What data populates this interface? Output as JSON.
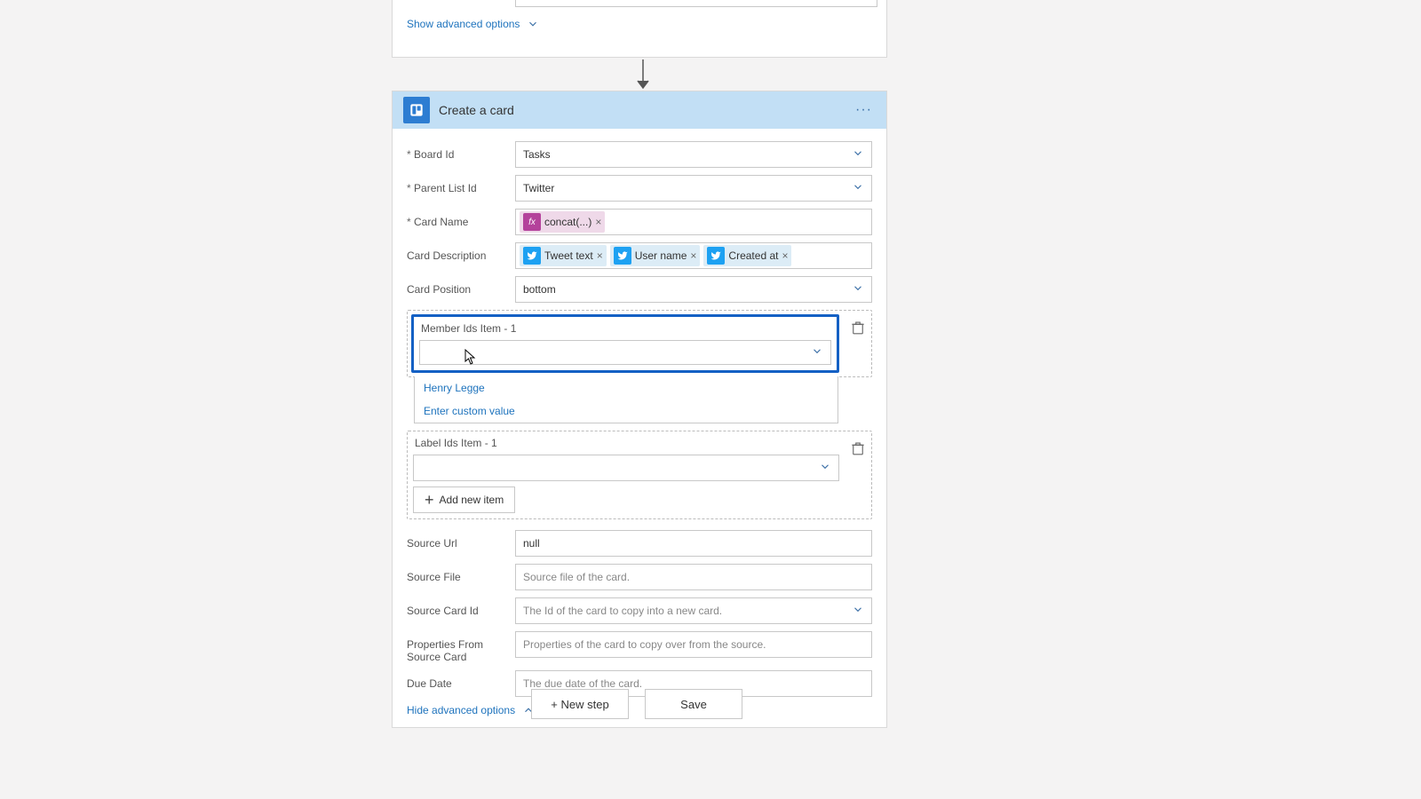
{
  "top_card": {
    "show_advanced": "Show advanced options"
  },
  "main_card": {
    "title": "Create a card",
    "fields": {
      "board_id": {
        "label": "Board Id",
        "value": "Tasks"
      },
      "parent_list": {
        "label": "Parent List Id",
        "value": "Twitter"
      },
      "card_name": {
        "label": "Card Name",
        "token_fx": "concat(...)"
      },
      "card_desc": {
        "label": "Card Description",
        "t1": "Tweet text",
        "t2": "User name",
        "t3": "Created at"
      },
      "card_pos": {
        "label": "Card Position",
        "value": "bottom"
      },
      "member_ids": {
        "label": "Member Ids Item - 1",
        "opt1": "Henry Legge",
        "opt2": "Enter custom value"
      },
      "label_ids": {
        "label": "Label Ids Item - 1"
      },
      "add_new": "Add new item",
      "source_url": {
        "label": "Source Url",
        "value": "null"
      },
      "source_file": {
        "label": "Source File",
        "placeholder": "Source file of the card."
      },
      "source_card": {
        "label": "Source Card Id",
        "placeholder": "The Id of the card to copy into a new card."
      },
      "props_source": {
        "label": "Properties From Source Card",
        "placeholder": "Properties of the card to copy over from the source."
      },
      "due_date": {
        "label": "Due Date",
        "placeholder": "The due date of the card."
      }
    },
    "hide_advanced": "Hide advanced options"
  },
  "footer": {
    "new_step": "+ New step",
    "save": "Save"
  }
}
